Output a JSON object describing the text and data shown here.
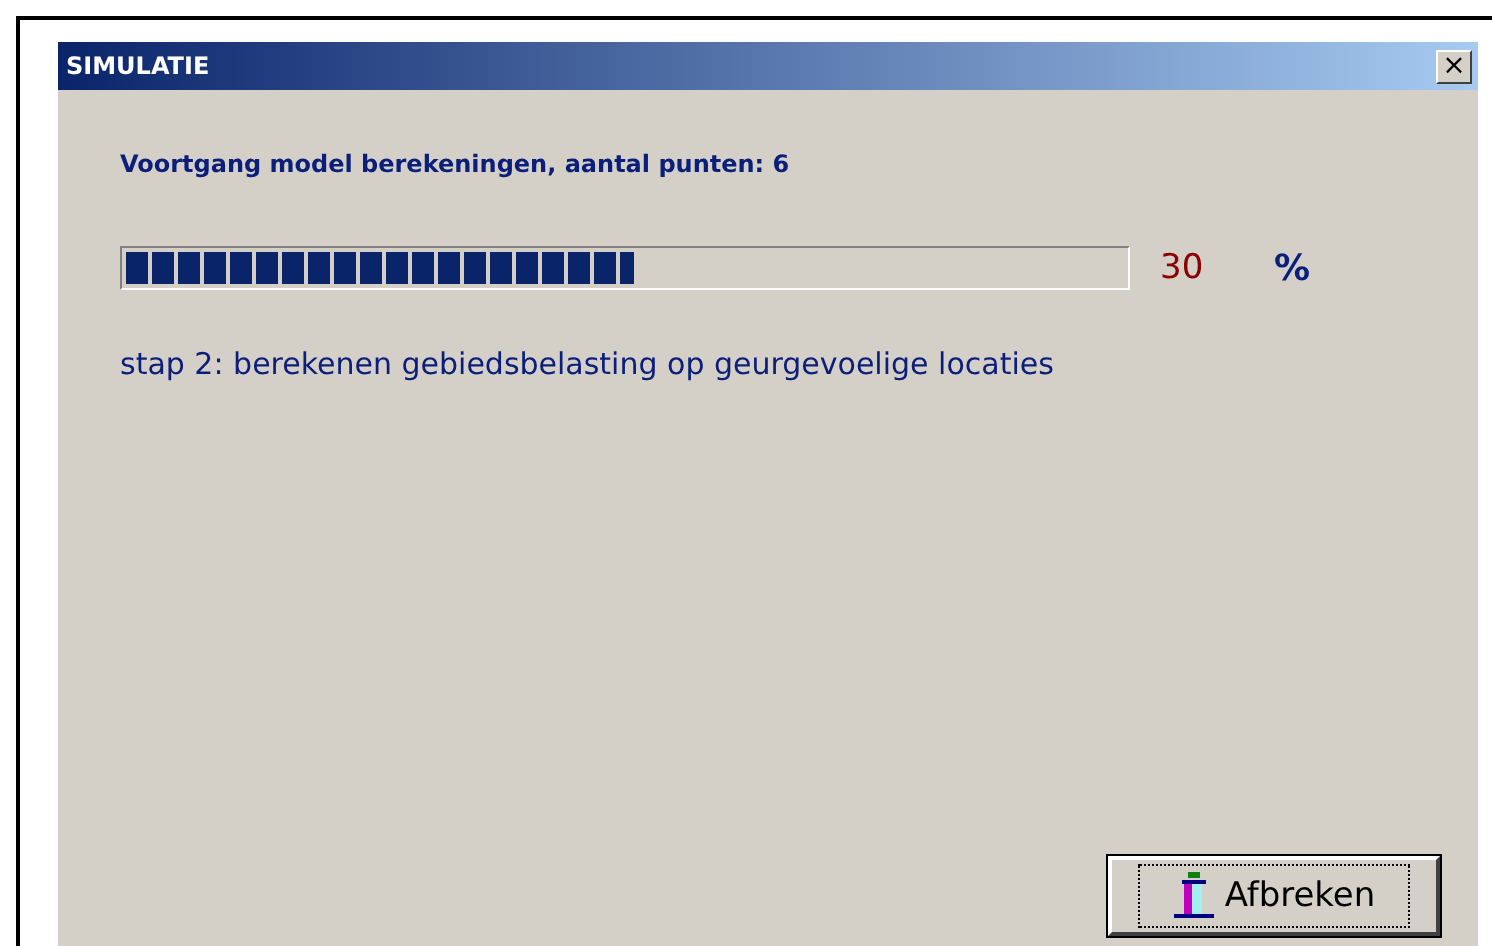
{
  "window": {
    "title": "SIMULATIE",
    "close": "×"
  },
  "heading": "Voortgang model berekeningen, aantal punten: 6",
  "progress": {
    "level": 0.51,
    "value": "30",
    "unit": "%"
  },
  "step": "stap 2: berekenen gebiedsbelasting op geurgevoelige locaties",
  "buttons": [
    {
      "label": "Afbreken",
      "focused": true
    }
  ]
}
